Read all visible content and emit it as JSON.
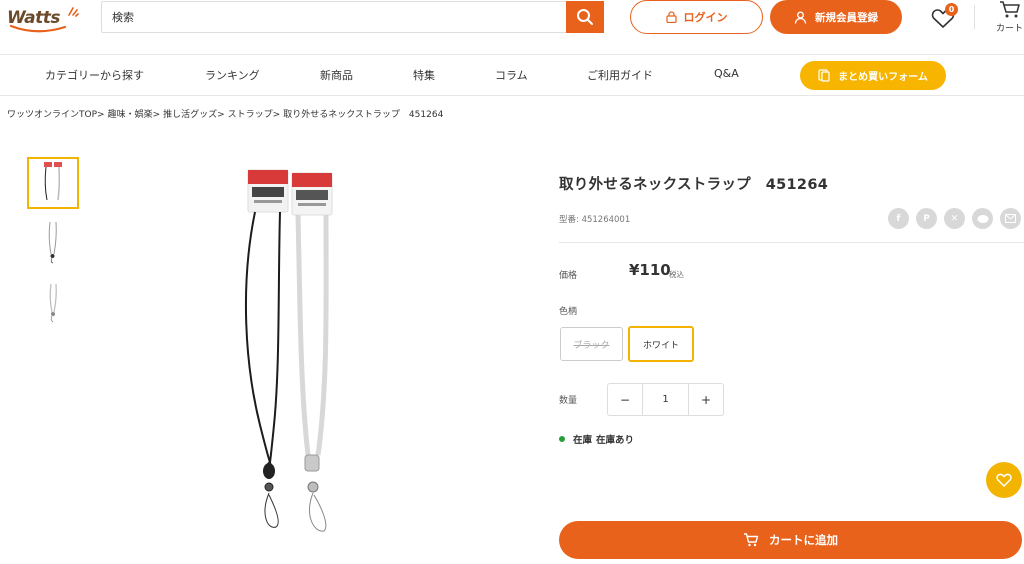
{
  "header": {
    "logo_text": "Watts",
    "search_placeholder": "検索",
    "login_label": "ログイン",
    "register_label": "新規会員登録",
    "favorites_count": "0",
    "cart_label": "カート"
  },
  "nav": {
    "items": [
      "カテゴリーから探す",
      "ランキング",
      "新商品",
      "特集",
      "コラム",
      "ご利用ガイド",
      "Q&A"
    ],
    "cta_label": "まとめ買いフォーム"
  },
  "breadcrumb": [
    "ワッツオンラインTOP>",
    "趣味・娯楽>",
    "推し活グッズ>",
    "ストラップ>",
    "取り外せるネックストラップ　451264"
  ],
  "product": {
    "title": "取り外せるネックストラップ　451264",
    "model": "型番: 451264001",
    "price_label": "価格",
    "price": "¥110",
    "tax_label": "税込",
    "color_label": "色柄",
    "colors": [
      {
        "label": "ブラック",
        "state": "disabled"
      },
      {
        "label": "ホワイト",
        "state": "selected"
      }
    ],
    "qty_label": "数量",
    "qty_value": "1",
    "qty_minus": "−",
    "qty_plus": "+",
    "stock_label": "在庫",
    "stock_value": "在庫あり",
    "add_to_cart": "カートに追加",
    "share_icons": [
      "facebook-icon",
      "pinterest-icon",
      "x-icon",
      "line-icon",
      "mail-icon"
    ]
  },
  "colors": {
    "accent_orange": "#e8621c",
    "accent_yellow": "#f2b400",
    "stock_green": "#2a9d3a"
  }
}
